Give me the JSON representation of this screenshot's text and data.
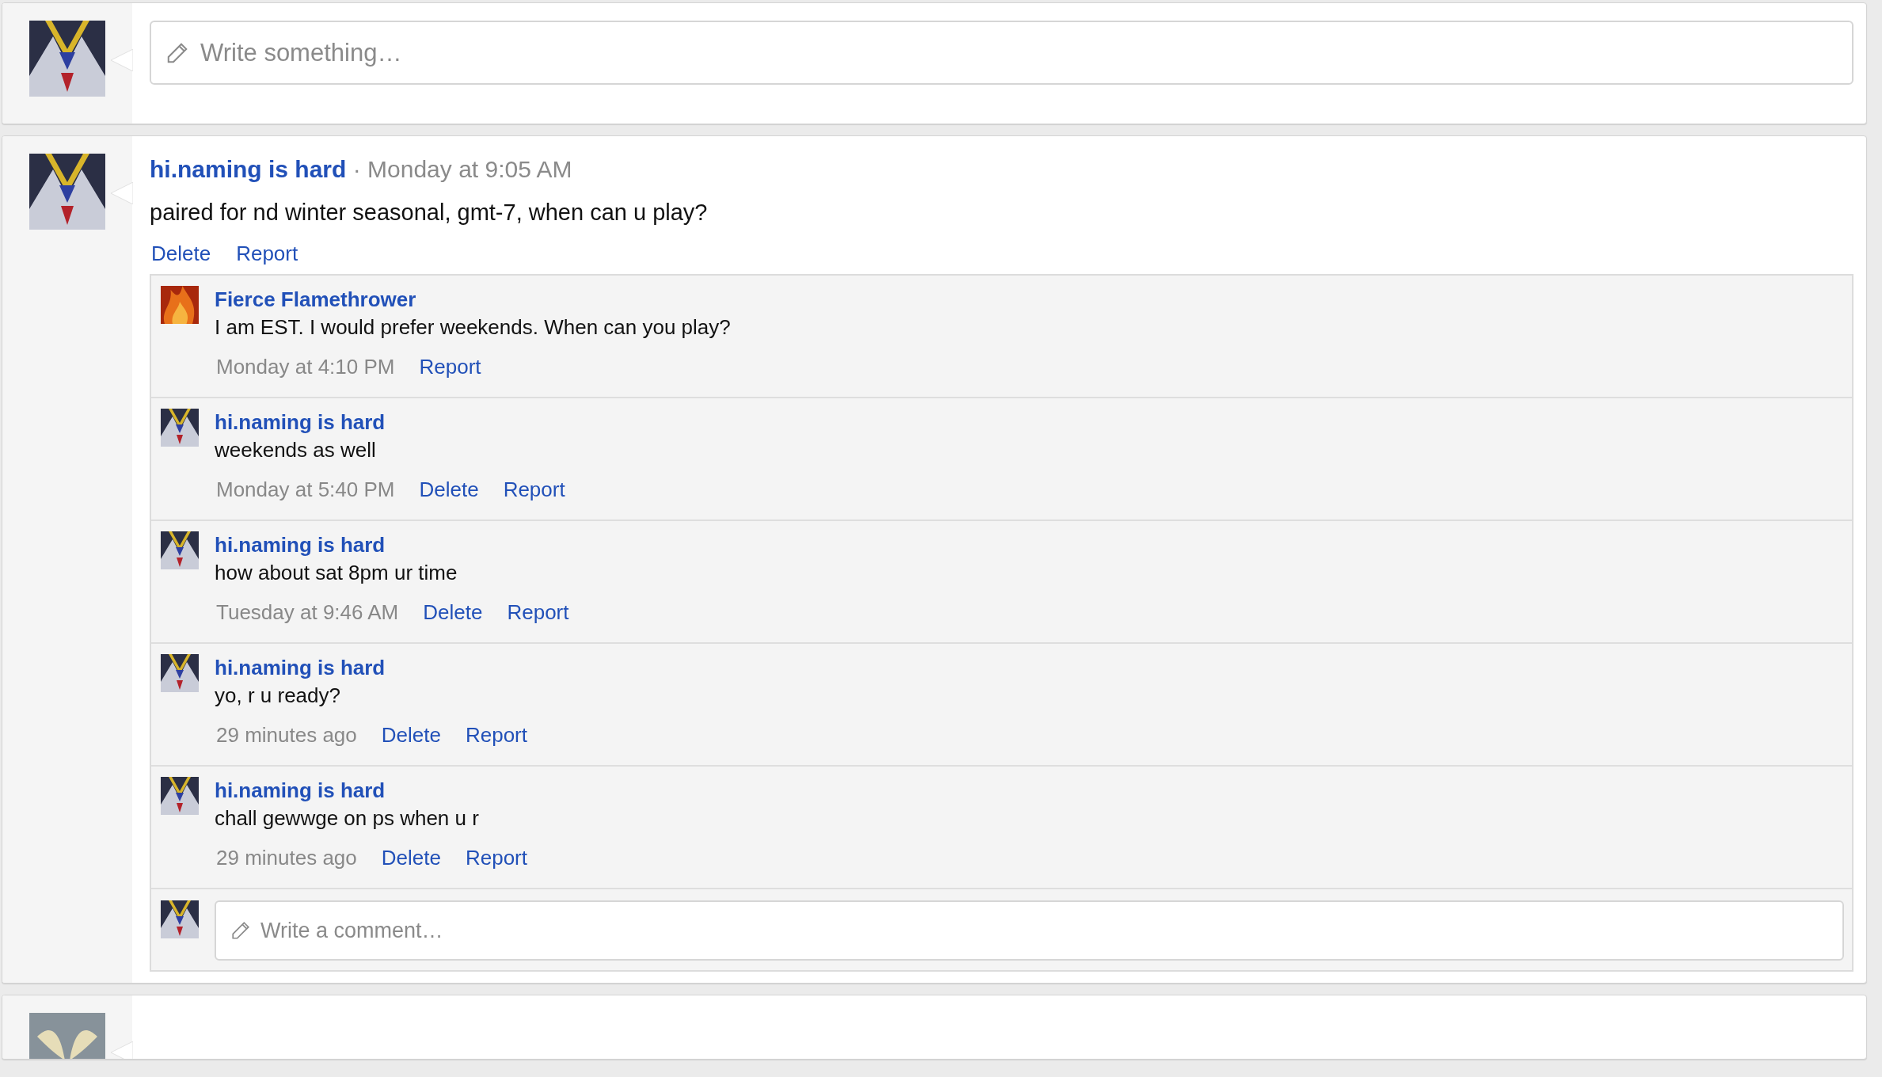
{
  "composer": {
    "avatar": {
      "kind": "robot"
    },
    "placeholder": "Write something…"
  },
  "posts": [
    {
      "avatar": {
        "kind": "robot"
      },
      "author": "hi.naming is hard",
      "separator": "·",
      "time": "Monday at 9:05 AM",
      "text": "paired for nd winter seasonal, gmt-7, when can u play?",
      "actions": [
        "Delete",
        "Report"
      ],
      "comments": [
        {
          "avatar": {
            "kind": "flame"
          },
          "author": "Fierce Flamethrower",
          "text": "I am EST. I would prefer weekends. When can you play?",
          "time": "Monday at 4:10 PM",
          "actions": [
            "Report"
          ]
        },
        {
          "avatar": {
            "kind": "robot"
          },
          "author": "hi.naming is hard",
          "text": "weekends as well",
          "time": "Monday at 5:40 PM",
          "actions": [
            "Delete",
            "Report"
          ]
        },
        {
          "avatar": {
            "kind": "robot"
          },
          "author": "hi.naming is hard",
          "text": "how about sat 8pm ur time",
          "time": "Tuesday at 9:46 AM",
          "actions": [
            "Delete",
            "Report"
          ]
        },
        {
          "avatar": {
            "kind": "robot"
          },
          "author": "hi.naming is hard",
          "text": "yo, r u ready?",
          "time": "29 minutes ago",
          "actions": [
            "Delete",
            "Report"
          ]
        },
        {
          "avatar": {
            "kind": "robot"
          },
          "author": "hi.naming is hard",
          "text": "chall gewwge on ps when u r",
          "time": "29 minutes ago",
          "actions": [
            "Delete",
            "Report"
          ]
        }
      ],
      "reply": {
        "avatar": {
          "kind": "robot"
        },
        "placeholder": "Write a comment…"
      }
    },
    {
      "avatar": {
        "kind": "wings"
      }
    }
  ]
}
